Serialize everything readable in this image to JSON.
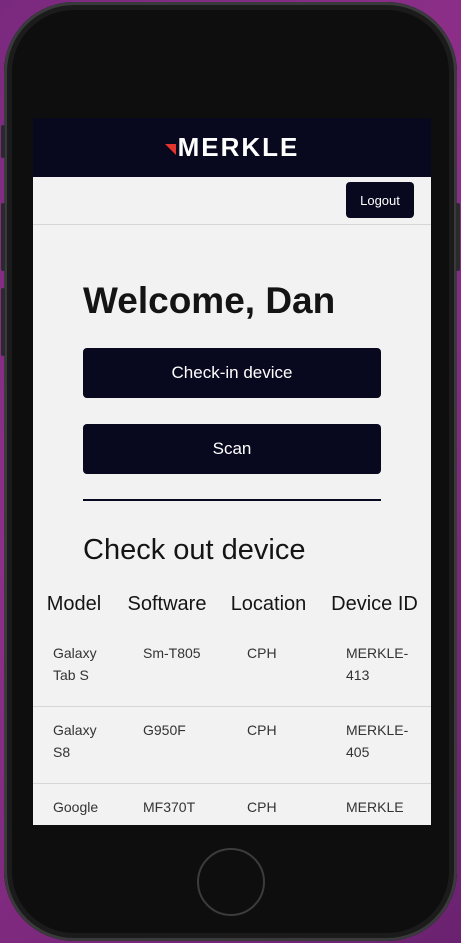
{
  "header": {
    "logo_text": "MERKLE",
    "accent_color": "#e3342f",
    "bar_color": "#08081f"
  },
  "toolbar": {
    "logout_label": "Logout"
  },
  "main": {
    "welcome": "Welcome, Dan",
    "checkin_label": "Check-in device",
    "scan_label": "Scan",
    "section_title": "Check out device"
  },
  "table": {
    "headers": [
      "Model",
      "Software",
      "Location",
      "Device ID"
    ],
    "rows": [
      [
        "Galaxy Tab S",
        "Sm-T805",
        "CPH",
        "MERKLE-413"
      ],
      [
        "Galaxy S8",
        "G950F",
        "CPH",
        "MERKLE-405"
      ],
      [
        "Google",
        "MF370T",
        "CPH",
        "MERKLE"
      ]
    ]
  }
}
